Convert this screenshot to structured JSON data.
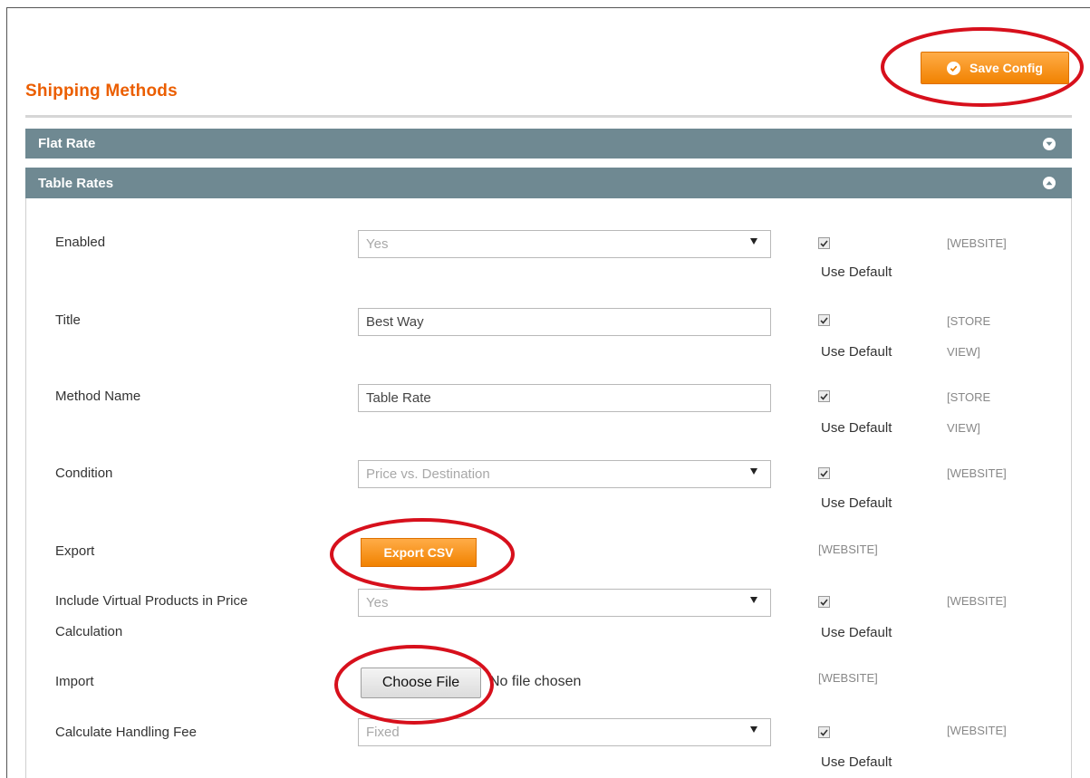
{
  "page": {
    "title": "Shipping Methods",
    "save_label": "Save Config"
  },
  "sections": {
    "flat_rate": "Flat Rate",
    "table_rates": "Table Rates"
  },
  "fields": {
    "enabled": {
      "label": "Enabled",
      "value": "Yes",
      "use_default": "Use Default",
      "scope": "[WEBSITE]"
    },
    "title": {
      "label": "Title",
      "value": "Best Way",
      "use_default": "Use Default",
      "scope_line1": "[STORE",
      "scope_line2": "VIEW]"
    },
    "method_name": {
      "label": "Method Name",
      "value": "Table Rate",
      "use_default": "Use Default",
      "scope_line1": "[STORE",
      "scope_line2": "VIEW]"
    },
    "condition": {
      "label": "Condition",
      "value": "Price vs. Destination",
      "use_default": "Use Default",
      "scope": "[WEBSITE]"
    },
    "export": {
      "label": "Export",
      "button": "Export CSV",
      "scope": "[WEBSITE]"
    },
    "include_virtual": {
      "label_line1": "Include Virtual Products in Price",
      "label_line2": "Calculation",
      "value": "Yes",
      "use_default": "Use Default",
      "scope": "[WEBSITE]"
    },
    "import": {
      "label": "Import",
      "button": "Choose File",
      "status": "No file chosen",
      "scope": "[WEBSITE]"
    },
    "handling_fee": {
      "label": "Calculate Handling Fee",
      "value": "Fixed",
      "use_default": "Use Default",
      "scope": "[WEBSITE]"
    }
  },
  "colors": {
    "accent_orange": "#eb5e00",
    "button_orange": "#f18200",
    "section_header": "#6f8992",
    "annotation_red": "#d7101c"
  },
  "icons": {
    "save": "check-circle-icon",
    "flat_rate_toggle": "chevron-down-circle-icon",
    "table_rates_toggle": "chevron-up-circle-icon",
    "select_arrow": "triangle-down-icon",
    "checkbox": "checkmark-icon"
  }
}
